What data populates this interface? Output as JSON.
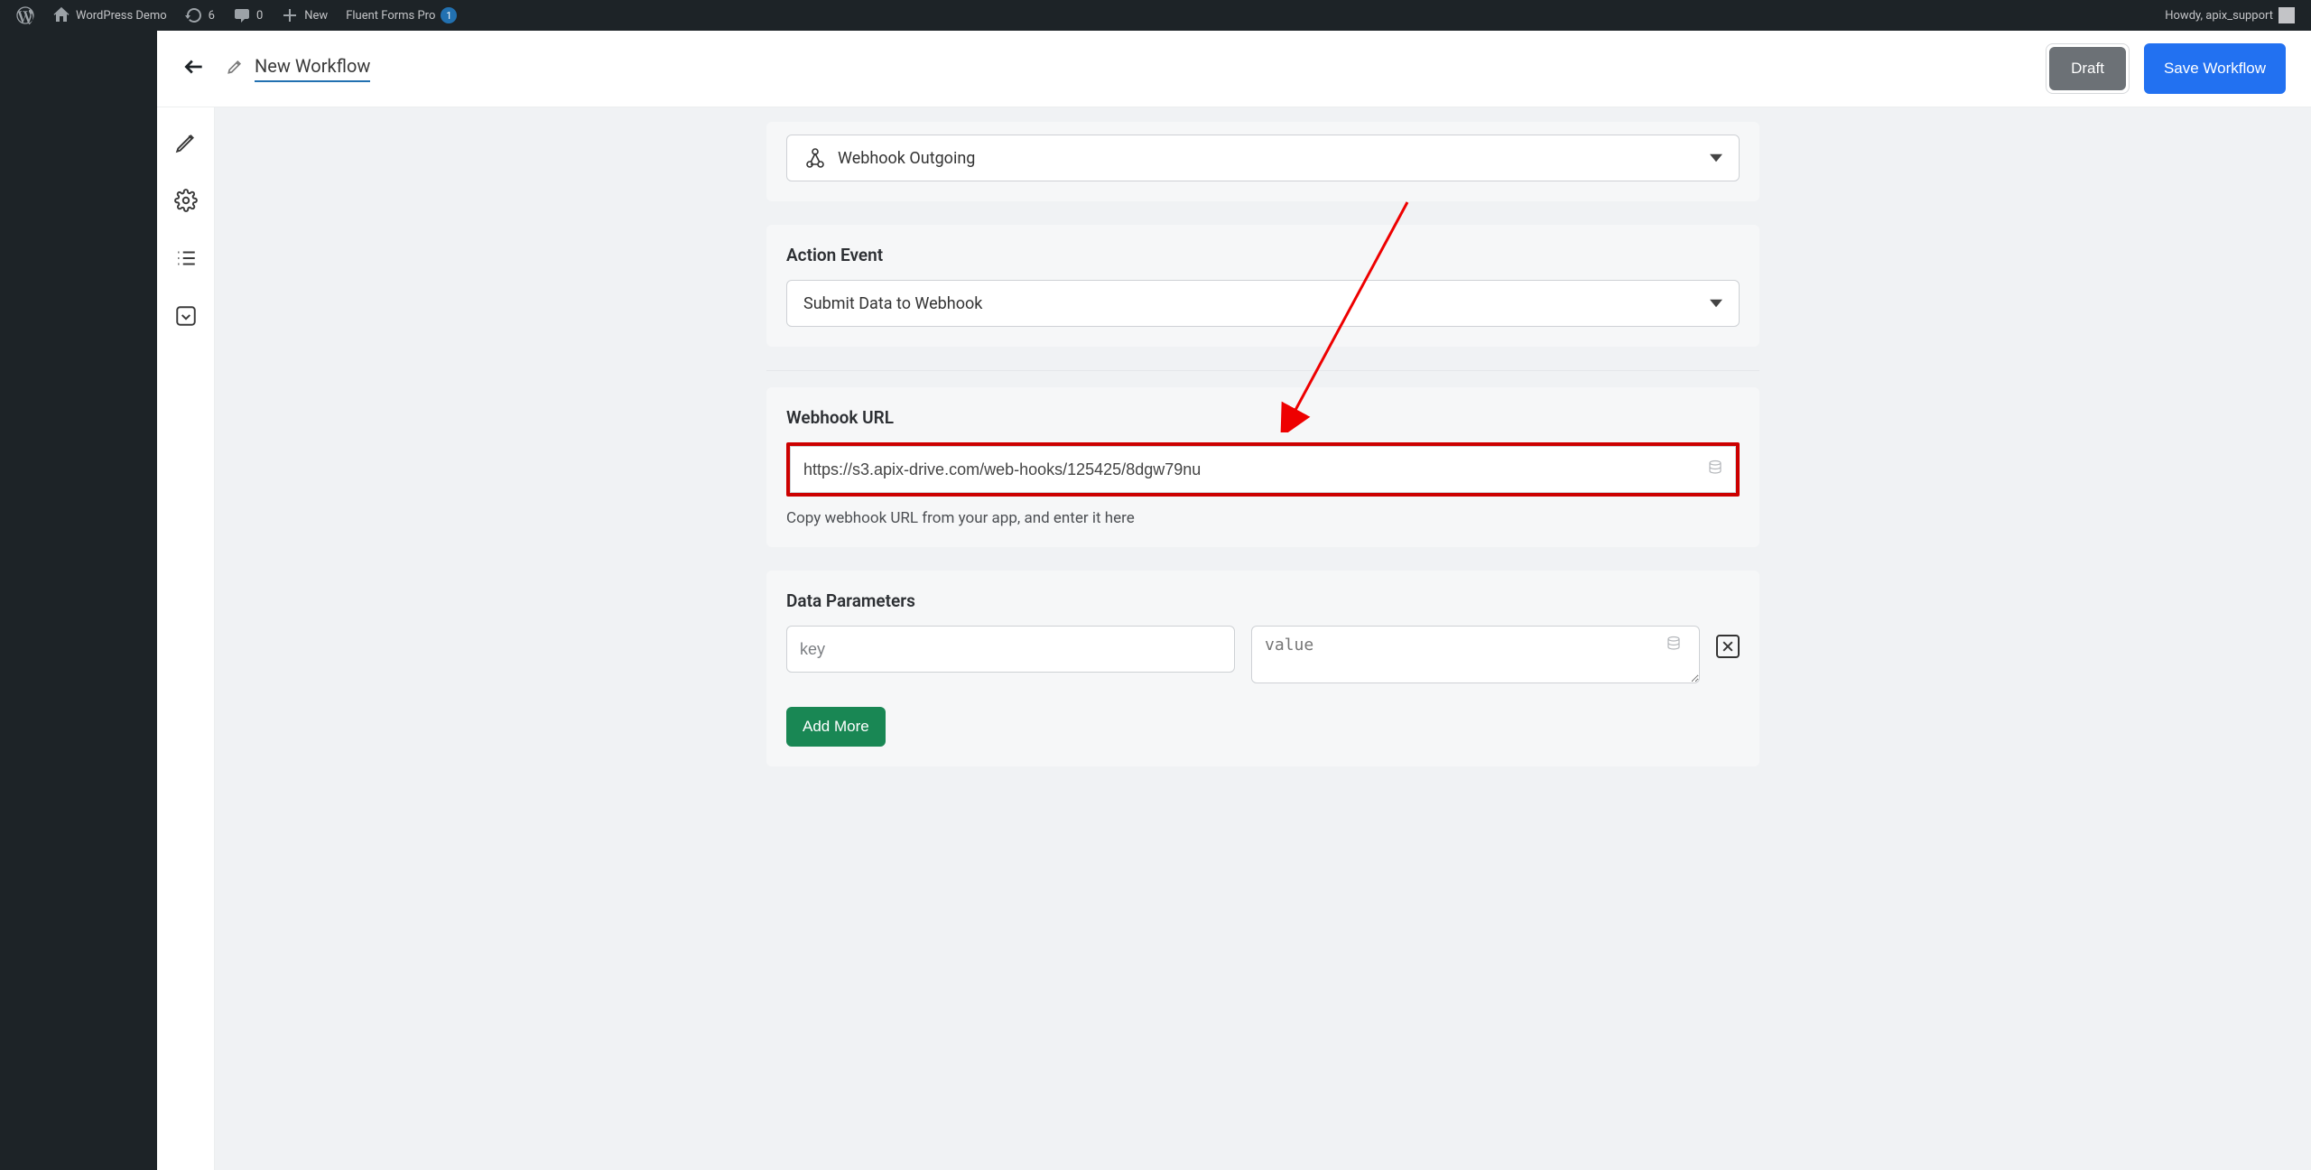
{
  "adminbar": {
    "site_name": "WordPress Demo",
    "updates_count": "6",
    "comments_count": "0",
    "new_label": "New",
    "plugin_label": "Fluent Forms Pro",
    "plugin_badge": "1",
    "howdy": "Howdy, apix_support"
  },
  "header": {
    "title": "New Workflow",
    "draft_btn": "Draft",
    "save_btn": "Save Workflow"
  },
  "app_selector": {
    "label": "Webhook Outgoing"
  },
  "action_event": {
    "title": "Action Event",
    "selected": "Submit Data to Webhook"
  },
  "webhook_url": {
    "title": "Webhook URL",
    "value": "https://s3.apix-drive.com/web-hooks/125425/8dgw79nu",
    "help": "Copy webhook URL from your app, and enter it here"
  },
  "data_params": {
    "title": "Data Parameters",
    "key_ph": "key",
    "value_ph": "value",
    "add_more": "Add More"
  }
}
